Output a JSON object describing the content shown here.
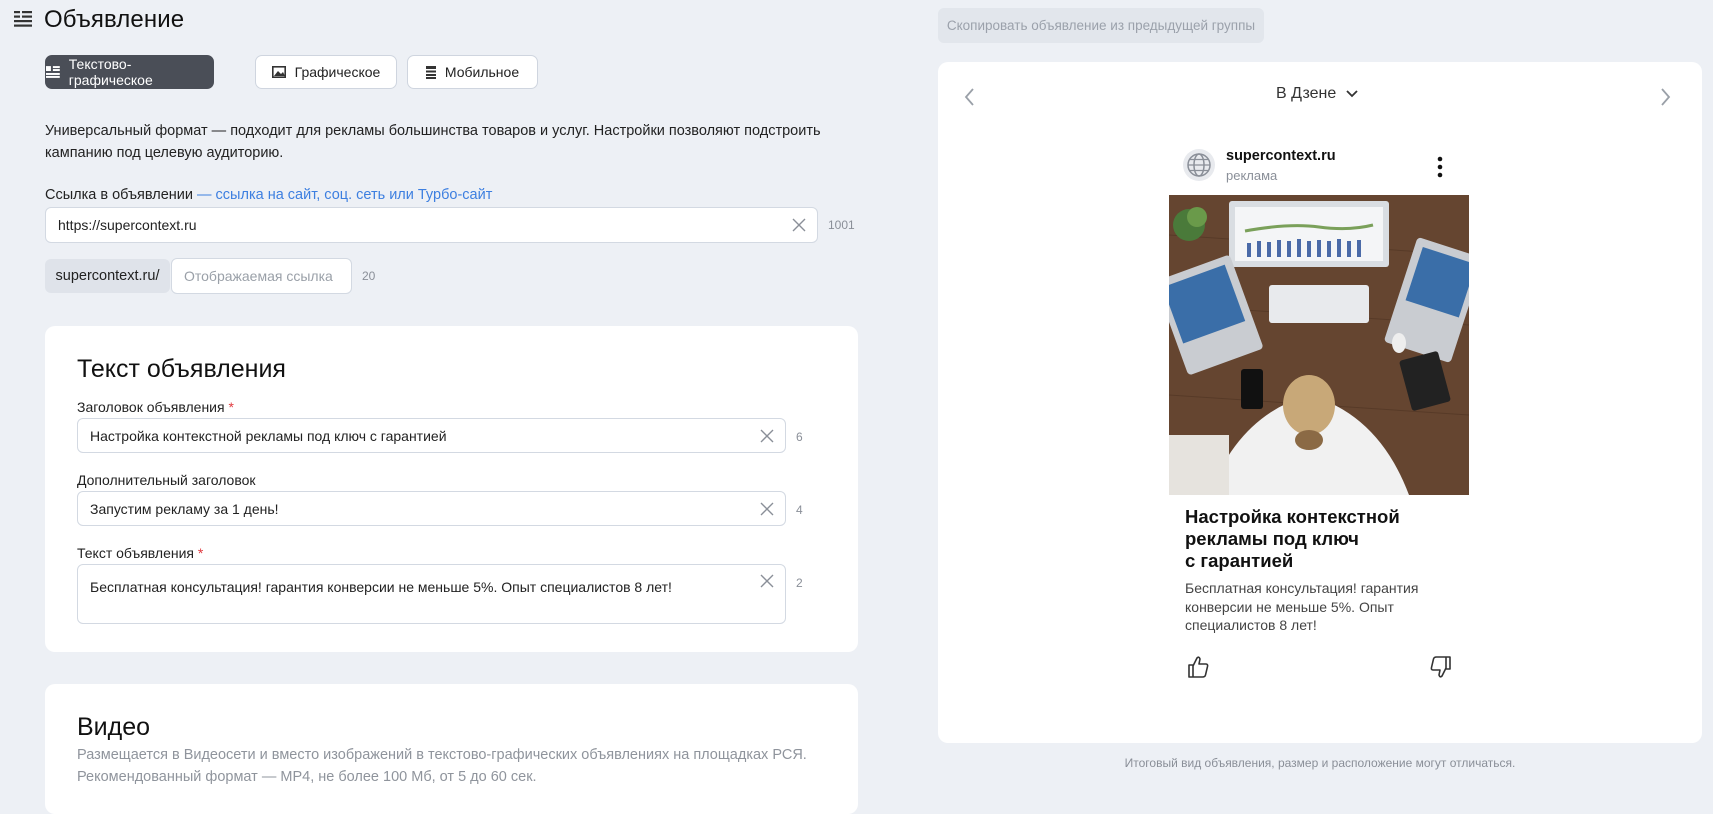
{
  "header": {
    "title": "Объявление"
  },
  "format_tabs": [
    {
      "label": "Текстово-графическое",
      "active": true,
      "icon": "text-graphic-icon"
    },
    {
      "label": "Графическое",
      "active": false,
      "icon": "image-icon"
    },
    {
      "label": "Мобильное",
      "active": false,
      "icon": "mobile-icon"
    }
  ],
  "description": "Универсальный формат — подходит для рекламы большинства товаров и услуг. Настройки позволяют подстроить кампанию под целевую аудиторию.",
  "link": {
    "label": "Ссылка в объявлении",
    "hint": "— ссылка на сайт, соц. сеть или Турбо-сайт",
    "value": "https://supercontext.ru",
    "counter": "1001"
  },
  "display_link": {
    "prefix": "supercontext.ru/",
    "placeholder": "Отображаемая ссылка",
    "counter": "20"
  },
  "ad_text_section": {
    "title": "Текст объявления",
    "fields": [
      {
        "label": "Заголовок объявления",
        "required": "*",
        "value": "Настройка контекстной рекламы под ключ с гарантией",
        "counter": "6"
      },
      {
        "label": "Дополнительный заголовок",
        "required": "",
        "value": "Запустим рекламу за 1 день!",
        "counter": "4"
      },
      {
        "label": "Текст объявления",
        "required": "*",
        "value": "Бесплатная консультация! гарантия конверсии не меньше 5%. Опыт специалистов 8 лет!",
        "counter": "2"
      }
    ]
  },
  "video_section": {
    "title": "Видео",
    "line1": "Размещается в Видеосети и вместо изображений в текстово-графических объявлениях на площадках РСЯ.",
    "line2": "Рекомендованный формат — MP4, не более 100 Мб, от 5 до 60 сек."
  },
  "preview": {
    "copy_button": "Скопировать объявление из предыдущей группы",
    "placement": "В Дзене",
    "domain": "supercontext.ru",
    "ad_label": "реклама",
    "title_lines": [
      "Настройка контекстной",
      "рекламы под ключ",
      "с гарантией"
    ],
    "text_lines": [
      "Бесплатная консультация! гарантия",
      "конверсии не меньше 5%. Опыт",
      "специалистов 8 лет!"
    ],
    "disclaimer": "Итоговый вид объявления, размер и расположение могут отличаться."
  },
  "colors": {
    "accent": "#3d7fe0",
    "active_tab": "#4a4e57",
    "required": "#e0393e",
    "background": "#edf0f5"
  }
}
